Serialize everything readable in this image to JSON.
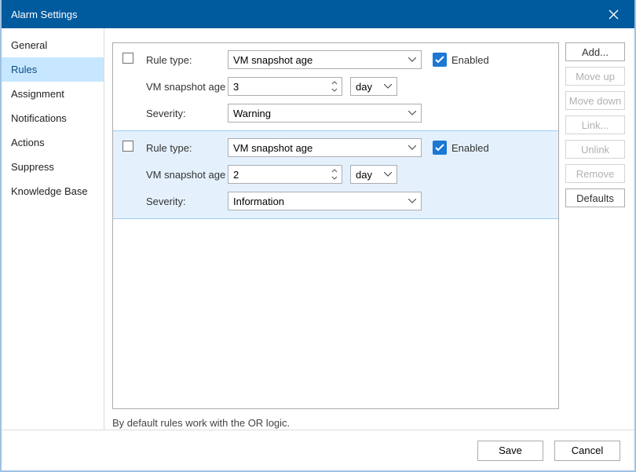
{
  "window": {
    "title": "Alarm Settings"
  },
  "sidebar": {
    "items": [
      {
        "label": "General"
      },
      {
        "label": "Rules",
        "selected": true
      },
      {
        "label": "Assignment"
      },
      {
        "label": "Notifications"
      },
      {
        "label": "Actions"
      },
      {
        "label": "Suppress"
      },
      {
        "label": "Knowledge Base"
      }
    ]
  },
  "labels": {
    "rule_type": "Rule type:",
    "vm_snapshot_age": "VM snapshot age",
    "severity": "Severity:",
    "enabled": "Enabled"
  },
  "rules": [
    {
      "type": "VM snapshot age",
      "enabled": true,
      "age_value": "3",
      "age_unit": "day",
      "severity": "Warning",
      "selected": false
    },
    {
      "type": "VM snapshot age",
      "enabled": true,
      "age_value": "2",
      "age_unit": "day",
      "severity": "Information",
      "selected": true
    }
  ],
  "hint": "By default rules work with the OR logic.",
  "buttons": {
    "add": "Add...",
    "move_up": "Move up",
    "move_down": "Move down",
    "link": "Link...",
    "unlink": "Unlink",
    "remove": "Remove",
    "defaults": "Defaults",
    "save": "Save",
    "cancel": "Cancel"
  }
}
